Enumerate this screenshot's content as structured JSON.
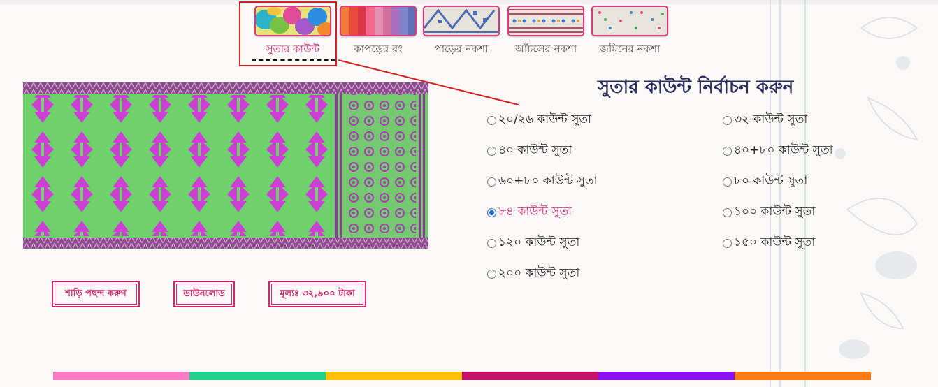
{
  "tabs": [
    {
      "label": "সুতার কাউন্ট",
      "icon": "yarn-skeins-thumbnail",
      "active": true
    },
    {
      "label": "কাপড়ের রং",
      "icon": "fabric-colors-thumbnail",
      "active": false
    },
    {
      "label": "পাড়ের নকশা",
      "icon": "border-design-thumbnail",
      "active": false
    },
    {
      "label": "আঁচলের নকশা",
      "icon": "anchal-design-thumbnail",
      "active": false
    },
    {
      "label": "জমিনের নকশা",
      "icon": "body-design-thumbnail",
      "active": false
    }
  ],
  "section_title": "সুতার কাউন্ট নির্বাচন করুন",
  "options": [
    {
      "label": "২০/২৬ কাউন্ট সুতা",
      "selected": false
    },
    {
      "label": "৩২ কাউন্ট সুতা",
      "selected": false
    },
    {
      "label": "৪০ কাউন্ট সুতা",
      "selected": false
    },
    {
      "label": "৪০+৮০ কাউন্ট সুতা",
      "selected": false
    },
    {
      "label": "৬০+৮০ কাউন্ট সুতা",
      "selected": false
    },
    {
      "label": "৮০ কাউন্ট সুতা",
      "selected": false
    },
    {
      "label": "৮৪ কাউন্ট সুতা",
      "selected": true
    },
    {
      "label": "১০০ কাউন্ট সুতা",
      "selected": false
    },
    {
      "label": "১২০ কাউন্ট সুতা",
      "selected": false
    },
    {
      "label": "১৫০ কাউন্ট সুতা",
      "selected": false
    },
    {
      "label": "২০০ কাউন্ট সুতা",
      "selected": false
    }
  ],
  "buttons": {
    "choose_saree": "শাড়ি পছন্দ করুণ",
    "download": "ডাউনলোড",
    "price": "মূল্যঃ ৩২,৯০০ টাকা"
  },
  "colors": {
    "accent": "#d6266f",
    "highlight_box": "#d32020",
    "title": "#2b2d5c",
    "saree_body": "#6fd16c",
    "saree_motif": "#cc3fd3",
    "saree_border": "#8b4a8e"
  },
  "color_bar": [
    "#ff7ac5",
    "#1fd48a",
    "#ffc10a",
    "#c8136b",
    "#8b10f0",
    "#ff7a10"
  ]
}
